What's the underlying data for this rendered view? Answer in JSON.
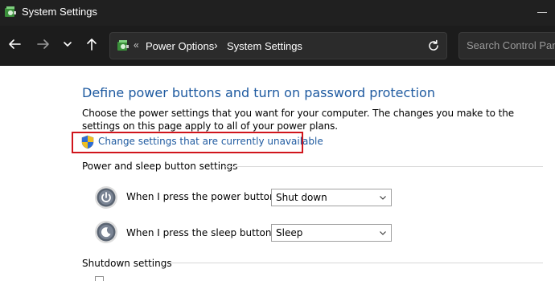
{
  "window": {
    "title": "System Settings"
  },
  "nav": {
    "breadcrumb": [
      "Power Options",
      "System Settings"
    ],
    "search_placeholder": "Search Control Panel"
  },
  "page": {
    "heading": "Define power buttons and turn on password protection",
    "description": "Choose the power settings that you want for your computer. The changes you make to the settings on this page apply to all of your power plans.",
    "change_link": "Change settings that are currently unavailable",
    "power_sleep_section": "Power and sleep button settings",
    "power_button_label": "When I press the power button:",
    "power_button_value": "Shut down",
    "sleep_button_label": "When I press the sleep button:",
    "sleep_button_value": "Sleep",
    "shutdown_section": "Shutdown settings"
  },
  "colors": {
    "link_blue": "#1e5aa0",
    "highlight_red": "#d0151c",
    "titlebar": "#202020",
    "navbar": "#1c1c1c"
  },
  "icons": {
    "app": "power-options-icon",
    "back": "arrow-left-icon",
    "forward": "arrow-right-icon",
    "recent": "chevron-down-icon",
    "up": "arrow-up-icon",
    "refresh": "refresh-icon",
    "shield": "uac-shield-icon",
    "power": "power-button-icon",
    "sleep": "sleep-button-icon"
  }
}
